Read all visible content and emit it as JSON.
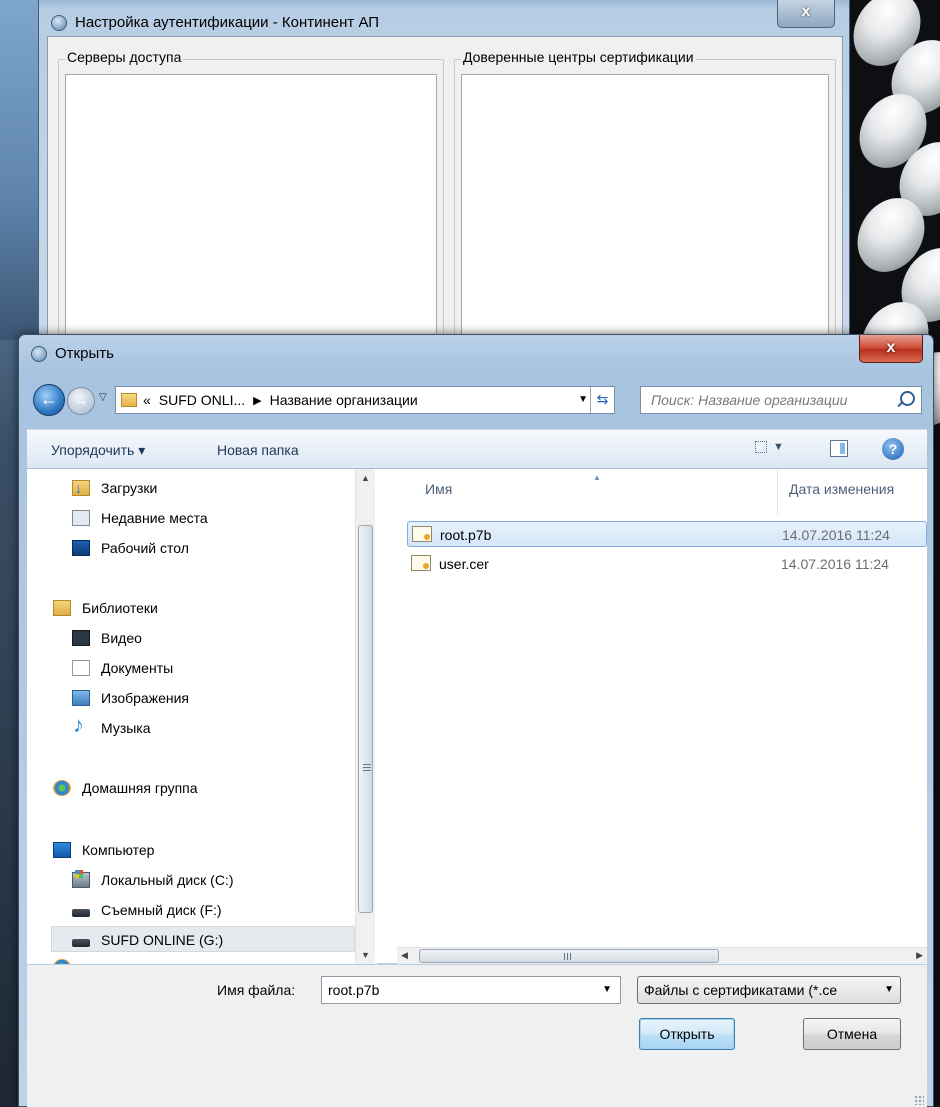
{
  "back_window": {
    "title": "Настройка аутентификации - Континент АП",
    "close_label": "x",
    "groups": [
      {
        "label": "Серверы доступа"
      },
      {
        "label": "Доверенные центры сертификации"
      }
    ]
  },
  "dialog": {
    "title": "Открыть",
    "close_label": "x",
    "address": {
      "prefix": "«",
      "crumbs": [
        "SUFD ONLI...",
        "Название организации"
      ]
    },
    "search_placeholder": "Поиск: Название организации",
    "toolbar": {
      "organize": "Упорядочить ▾",
      "new_folder": "Новая папка",
      "help": "?"
    },
    "nav_items": [
      {
        "label": "Загрузки",
        "icon": "downloads-icon"
      },
      {
        "label": "Недавние места",
        "icon": "recent-places-icon"
      },
      {
        "label": "Рабочий стол",
        "icon": "desktop-icon"
      },
      {
        "label": "Библиотеки",
        "icon": "libraries-icon"
      },
      {
        "label": "Видео",
        "icon": "video-icon"
      },
      {
        "label": "Документы",
        "icon": "documents-icon"
      },
      {
        "label": "Изображения",
        "icon": "images-icon"
      },
      {
        "label": "Музыка",
        "icon": "music-icon"
      },
      {
        "label": "Домашняя группа",
        "icon": "homegroup-icon"
      },
      {
        "label": "Компьютер",
        "icon": "computer-icon"
      },
      {
        "label": "Локальный диск (C:)",
        "icon": "local-disk-icon"
      },
      {
        "label": "Съемный диск (F:)",
        "icon": "removable-disk-icon"
      },
      {
        "label": "SUFD ONLINE (G:)",
        "icon": "drive-icon",
        "selected": true
      }
    ],
    "columns": {
      "name": "Имя",
      "date": "Дата изменения"
    },
    "files": [
      {
        "name": "root.p7b",
        "date": "14.07.2016 11:24",
        "selected": true
      },
      {
        "name": "user.cer",
        "date": "14.07.2016 11:24",
        "selected": false
      }
    ],
    "filename_label": "Имя файла:",
    "filename_value": "root.p7b",
    "filetype_value": "Файлы с сертификатами (*.ce",
    "open_button": "Открыть",
    "cancel_button": "Отмена"
  },
  "colors": {
    "selection_border": "#84acdd",
    "close_red": "#c8402a",
    "title_bar_blue": "#b9d1ea"
  }
}
